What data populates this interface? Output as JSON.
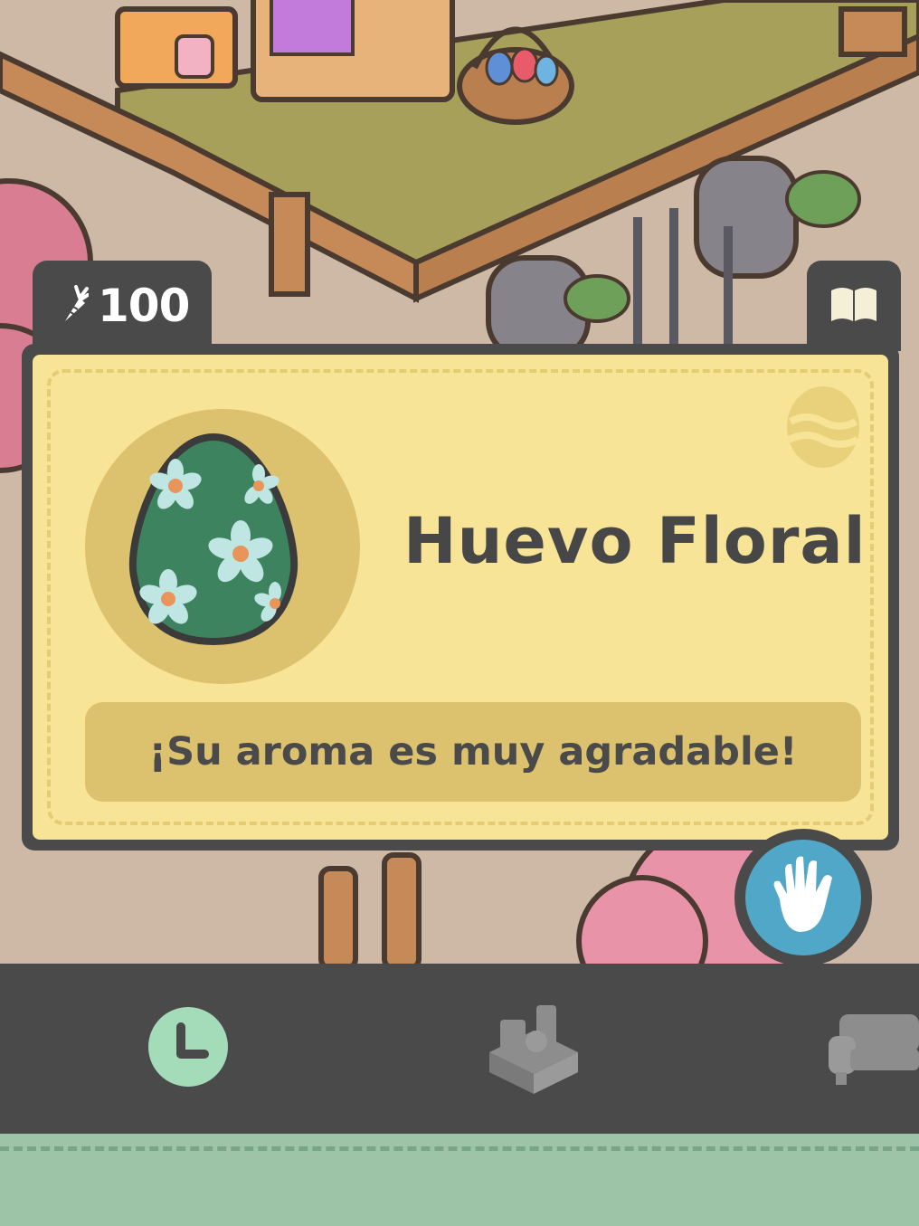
{
  "currency": {
    "amount": "100",
    "icon": "carrot-icon"
  },
  "item": {
    "name": "Huevo Floral",
    "description": "¡Su aroma es muy agradable!",
    "icon": "floral-egg-icon",
    "type_icon": "egg-category-icon"
  },
  "actions": {
    "interact_icon": "hand-icon",
    "journal_icon": "book-icon"
  },
  "nav": [
    {
      "name": "clock-tab",
      "icon": "clock-icon",
      "active": true
    },
    {
      "name": "furniture-box-tab",
      "icon": "box-icon",
      "active": false
    },
    {
      "name": "sofa-tab",
      "icon": "sofa-icon",
      "active": false
    }
  ],
  "colors": {
    "card_bg": "#f8e497",
    "card_frame": "#4a4a4a",
    "accent_gold": "#dcc26e",
    "nav_bg": "#4a4a4a",
    "active_tab": "#a4dbb8",
    "tray_bg": "#9ec4a8",
    "hand_button": "#51a7c7",
    "egg_green": "#3e8360"
  }
}
